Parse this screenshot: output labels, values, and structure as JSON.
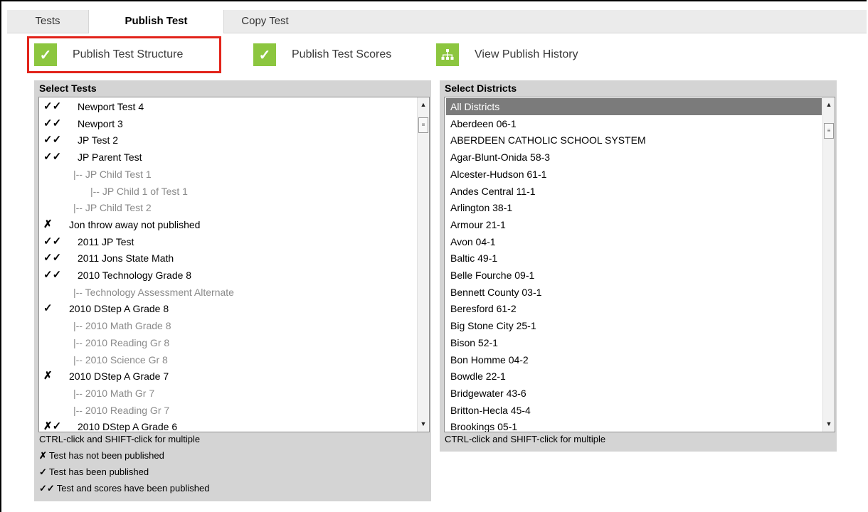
{
  "tabs": [
    {
      "label": "Tests"
    },
    {
      "label": "Publish Test"
    },
    {
      "label": "Copy Test"
    }
  ],
  "actions": [
    {
      "icon": "check-icon",
      "glyph": "✓",
      "label": "Publish Test Structure"
    },
    {
      "icon": "check-icon",
      "glyph": "✓",
      "label": "Publish Test Scores"
    },
    {
      "icon": "hierarchy-icon",
      "glyph": "ஃ",
      "label": "View Publish History"
    }
  ],
  "colors": {
    "accent": "#8cc63f",
    "highlight": "#e2231a",
    "selected_row": "#7b7b7b"
  },
  "tests_panel": {
    "title": "Select Tests",
    "items": [
      {
        "mark": "✓✓",
        "label": "Newport Test 4",
        "indent": 0
      },
      {
        "mark": "✓✓",
        "label": "Newport 3",
        "indent": 0
      },
      {
        "mark": "✓✓",
        "label": "JP Test 2",
        "indent": 0
      },
      {
        "mark": "✓✓",
        "label": "JP Parent Test",
        "indent": 0
      },
      {
        "mark": "",
        "label": "|-- JP Child Test 1",
        "indent": 1
      },
      {
        "mark": "",
        "label": "|-- JP Child 1 of Test 1",
        "indent": 2
      },
      {
        "mark": "",
        "label": "|-- JP Child Test 2",
        "indent": 1
      },
      {
        "mark": "✗",
        "label": "Jon throw away not published",
        "indent": 0
      },
      {
        "mark": "✓✓",
        "label": "2011 JP Test",
        "indent": 0
      },
      {
        "mark": "✓✓",
        "label": "2011 Jons State Math",
        "indent": 0
      },
      {
        "mark": "✓✓",
        "label": "2010 Technology Grade 8",
        "indent": 0
      },
      {
        "mark": "",
        "label": "|-- Technology Assessment Alternate",
        "indent": 1
      },
      {
        "mark": "✓",
        "label": "2010 DStep A Grade 8",
        "indent": 0
      },
      {
        "mark": "",
        "label": "|-- 2010 Math Grade 8",
        "indent": 1
      },
      {
        "mark": "",
        "label": "|-- 2010 Reading Gr 8",
        "indent": 1
      },
      {
        "mark": "",
        "label": "|-- 2010 Science Gr 8",
        "indent": 1
      },
      {
        "mark": "✗",
        "label": "2010 DStep A Grade 7",
        "indent": 0
      },
      {
        "mark": "",
        "label": "|-- 2010 Math Gr 7",
        "indent": 1
      },
      {
        "mark": "",
        "label": "|-- 2010 Reading Gr 7",
        "indent": 1
      },
      {
        "mark": "✗✓",
        "label": "2010 DStep A Grade 6",
        "indent": 0
      }
    ],
    "hint": "CTRL-click and SHIFT-click for multiple",
    "legend": [
      {
        "mark": "✗",
        "text": "Test has not been published"
      },
      {
        "mark": "✓",
        "text": "Test has been published"
      },
      {
        "mark": "✓✓",
        "text": "Test and scores have been published"
      }
    ]
  },
  "districts_panel": {
    "title": "Select Districts",
    "items": [
      "All Districts",
      "Aberdeen 06-1",
      "ABERDEEN CATHOLIC SCHOOL SYSTEM",
      "Agar-Blunt-Onida 58-3",
      "Alcester-Hudson 61-1",
      "Andes Central 11-1",
      "Arlington 38-1",
      "Armour 21-1",
      "Avon 04-1",
      "Baltic 49-1",
      "Belle Fourche 09-1",
      "Bennett County 03-1",
      "Beresford 61-2",
      "Big Stone City 25-1",
      "Bison 52-1",
      "Bon Homme 04-2",
      "Bowdle 22-1",
      "Bridgewater 43-6",
      "Britton-Hecla 45-4",
      "Brookings 05-1"
    ],
    "selected": "All Districts",
    "hint": "CTRL-click and SHIFT-click for multiple"
  }
}
